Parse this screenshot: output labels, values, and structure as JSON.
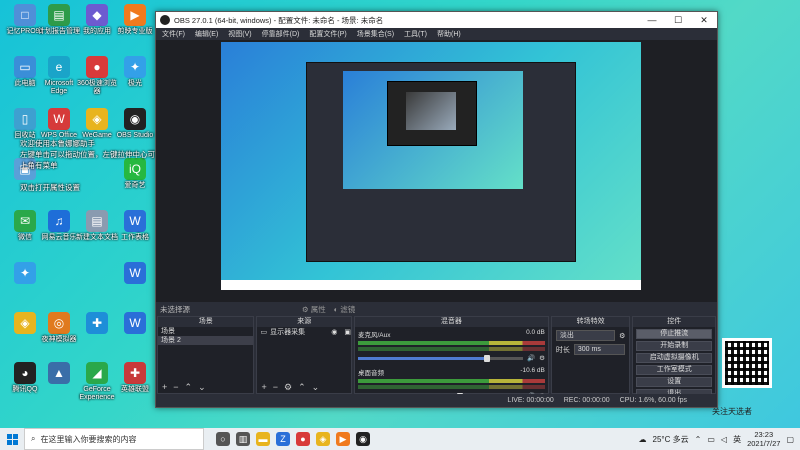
{
  "desktop": {
    "icons": [
      {
        "label": "记忆PRO91",
        "glyph": "□",
        "color": "#4f8fd8"
      },
      {
        "label": "计划报告管理",
        "glyph": "▤",
        "color": "#2e9b4a"
      },
      {
        "label": "我的应用",
        "glyph": "◆",
        "color": "#6d5bd0"
      },
      {
        "label": "剪映专业版",
        "glyph": "▶",
        "color": "#f07a1e"
      },
      {
        "label": "此电脑",
        "glyph": "▭",
        "color": "#3a8ed8"
      },
      {
        "label": "Microsoft Edge",
        "glyph": "e",
        "color": "#1aa4c9"
      },
      {
        "label": "360极速浏览器",
        "glyph": "●",
        "color": "#d83a3a"
      },
      {
        "label": "极光",
        "glyph": "✦",
        "color": "#33a0e8"
      },
      {
        "label": "WPS Office",
        "glyph": "W",
        "color": "#d63a3a"
      },
      {
        "label": "WeGame",
        "glyph": "◈",
        "color": "#e8b41e"
      },
      {
        "label": "OBS Studio",
        "glyph": "◉",
        "color": "#222"
      },
      {
        "label": "回收站",
        "glyph": "▯",
        "color": "#3ea0d0"
      },
      {
        "label": "微信",
        "glyph": "✉",
        "color": "#2aa84a"
      },
      {
        "label": "爱奇艺",
        "glyph": "iQ",
        "color": "#26b840"
      },
      {
        "label": "网易云音乐",
        "glyph": "♫",
        "color": "#1e6ed8"
      },
      {
        "label": "新建文本文档",
        "glyph": "▤",
        "color": "#8a9bb0"
      },
      {
        "label": "工作表格",
        "glyph": "W",
        "color": "#2a6fd8"
      },
      {
        "label": "夜神模拟器",
        "glyph": "◎",
        "color": "#e07a1e"
      },
      {
        "label": "GeForce Experience",
        "glyph": "◢",
        "color": "#2aa84a"
      },
      {
        "label": "英雄联盟",
        "glyph": "✚",
        "color": "#c83a3a"
      },
      {
        "label": "腾讯QQ",
        "glyph": "◕",
        "color": "#222"
      }
    ],
    "texts": [
      "欢迎使用本鲁娜娜助手",
      "左键单击可以拖动位置，左键拉伸中心可以放大小",
      "上角有菜单",
      "双击打开属性设置"
    ],
    "qr_label": "关注天选者"
  },
  "obs": {
    "title": "OBS 27.0.1 (64-bit, windows) - 配置文件: 未命名 - 场景: 未命名",
    "menu": [
      "文件(F)",
      "编辑(E)",
      "视图(V)",
      "停靠部件(D)",
      "配置文件(P)",
      "场景集合(S)",
      "工具(T)",
      "帮助(H)"
    ],
    "toolbar": {
      "scene_label": "未选择源",
      "props_label": "属性",
      "filters_label": "滤镜"
    },
    "scenes": {
      "header": "场景",
      "items": [
        "场景",
        "场景 2"
      ],
      "selected": 1
    },
    "sources": {
      "header": "来源",
      "items": [
        "显示器采集"
      ]
    },
    "mixer": {
      "header": "混音器",
      "channels": [
        {
          "name": "麦克风/Aux",
          "db": "0.0 dB",
          "level": 0.78
        },
        {
          "name": "桌面音频",
          "db": "-10.6 dB",
          "level": 0.62
        }
      ]
    },
    "transitions": {
      "header": "转场特效",
      "type_value": "淡出",
      "duration_label": "时长",
      "duration_value": "300 ms"
    },
    "controls": {
      "header": "控件",
      "buttons": [
        "停止推流",
        "开始录制",
        "启动虚拟摄像机",
        "工作室模式",
        "设置",
        "退出"
      ]
    },
    "status": {
      "live": "LIVE: 00:00:00",
      "rec": "REC: 00:00:00",
      "cpu": "CPU: 1.6%, 60.00 fps"
    }
  },
  "taskbar": {
    "search_placeholder": "在这里输入你要搜索的内容",
    "weather": "25°C 多云",
    "lang": "英",
    "time": "23:23",
    "date": "2021/7/27"
  }
}
